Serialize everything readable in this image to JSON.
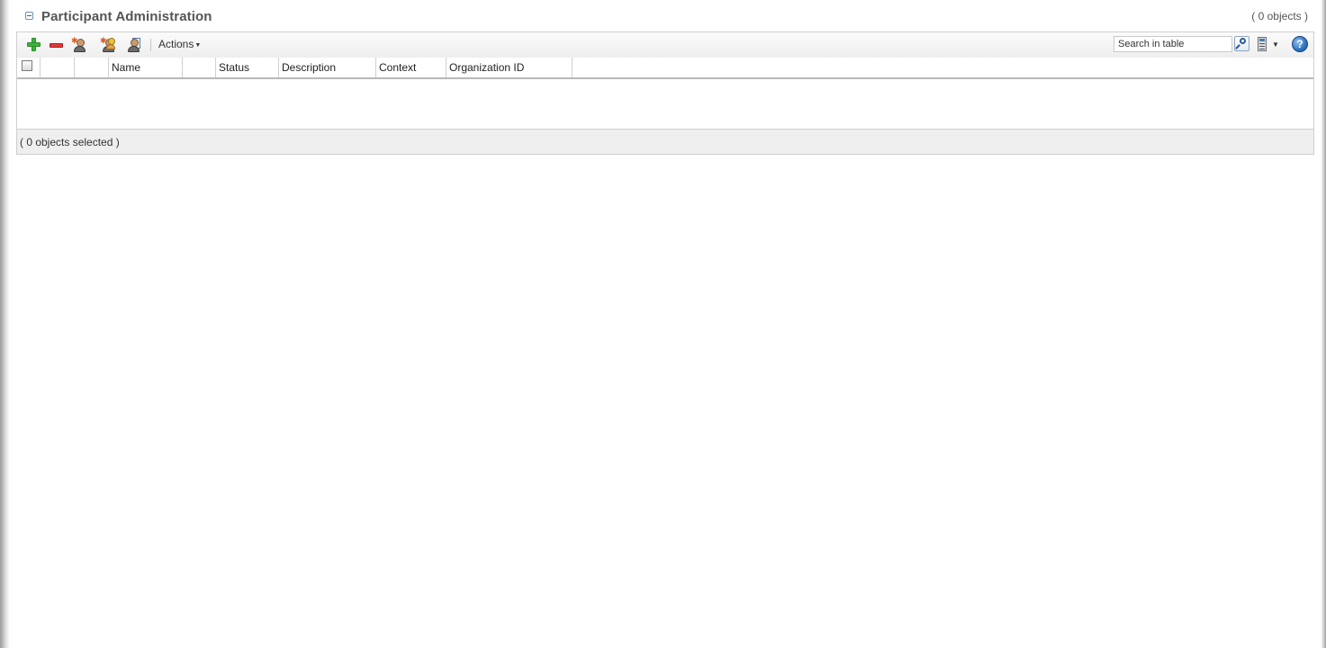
{
  "panel": {
    "title": "Participant Administration",
    "object_count": "( 0 objects )"
  },
  "toolbar": {
    "icons": [
      "add-icon",
      "remove-icon",
      "create-user-icon",
      "create-group-icon",
      "copy-participant-icon"
    ],
    "actions_label": "Actions",
    "search_placeholder": "Search in table",
    "right_icons": [
      "search-icon",
      "calculator-icon",
      "chevron-down-icon",
      "help-icon"
    ]
  },
  "table": {
    "columns": [
      "",
      "",
      "",
      "Name",
      "",
      "Status",
      "Description",
      "Context",
      "Organization ID"
    ],
    "rows": []
  },
  "footer": {
    "selection_text": "( 0 objects selected )"
  },
  "colors": {
    "title": "#555555",
    "toolbar_bg": "#eeeeee",
    "add": "#3bb53b",
    "remove": "#e03a3a",
    "help": "#2f74c0"
  }
}
